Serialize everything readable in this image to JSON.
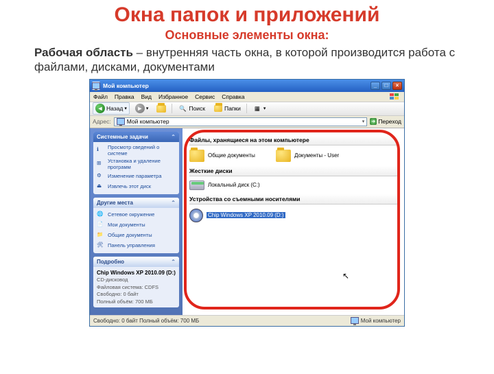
{
  "slide": {
    "title": "Окна папок и приложений",
    "subtitle": "Основные элементы окна:",
    "desc_bold": "Рабочая область",
    "desc_rest": " – внутренняя часть окна, в которой производится работа с файлами, дисками, документами"
  },
  "window": {
    "title": "Мой компьютер",
    "menus": [
      "Файл",
      "Правка",
      "Вид",
      "Избранное",
      "Сервис",
      "Справка"
    ],
    "toolbar": {
      "back": "Назад",
      "search": "Поиск",
      "folders": "Папки"
    },
    "address": {
      "label": "Адрес:",
      "value": "Мой компьютер",
      "go": "Переход"
    },
    "panels": {
      "system": {
        "title": "Системные задачи",
        "items": [
          "Просмотр сведений о системе",
          "Установка и удаление программ",
          "Изменение параметра",
          "Извлечь этот диск"
        ]
      },
      "other": {
        "title": "Другие места",
        "items": [
          "Сетевое окружение",
          "Мои документы",
          "Общие документы",
          "Панель управления"
        ]
      },
      "details": {
        "title": "Подробно",
        "name": "Chip Windows XP 2010.09 (D:)",
        "type": "CD-дисковод",
        "fs_label": "Файловая система: CDFS",
        "free_label": "Свободно: 0 байт",
        "total_label": "Полный объём: 700 МБ"
      }
    },
    "content": {
      "section1": "Файлы, хранящиеся на этом компьютере",
      "shared_docs": "Общие документы",
      "user_docs": "Документы - User",
      "section2": "Жесткие диски",
      "hdd": "Локальный диск (C:)",
      "section3": "Устройства со съемными носителями",
      "cd": "Chip Windows XP 2010.09 (D:)"
    },
    "status": {
      "left": "Свободно: 0 байт Полный объём: 700 МБ",
      "right": "Мой компьютер"
    }
  }
}
